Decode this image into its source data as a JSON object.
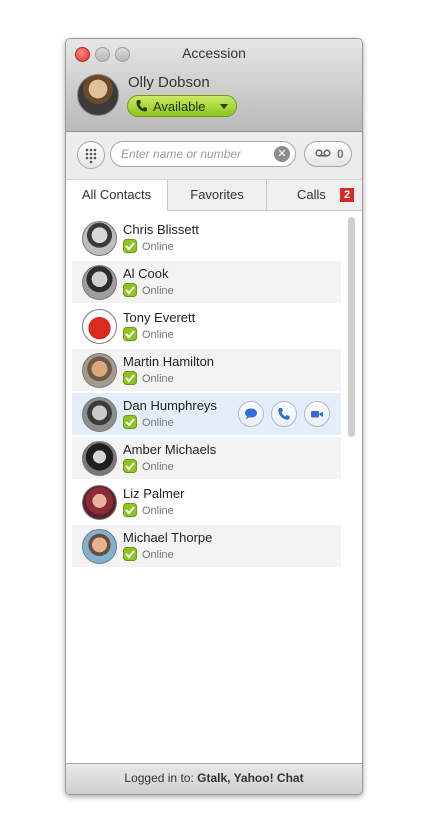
{
  "window": {
    "title": "Accession"
  },
  "user": {
    "name": "Olly Dobson",
    "status": "Available"
  },
  "toolbar": {
    "search_placeholder": "Enter name or number",
    "voicemail_count": "0"
  },
  "tabs": [
    {
      "label": "All Contacts",
      "active": true
    },
    {
      "label": "Favorites"
    },
    {
      "label": "Calls",
      "badge": "2"
    }
  ],
  "contacts": [
    {
      "name": "Chris Blissett",
      "status": "Online"
    },
    {
      "name": "Al Cook",
      "status": "Online"
    },
    {
      "name": "Tony Everett",
      "status": "Online"
    },
    {
      "name": "Martin Hamilton",
      "status": "Online"
    },
    {
      "name": "Dan Humphreys",
      "status": "Online"
    },
    {
      "name": "Amber Michaels",
      "status": "Online"
    },
    {
      "name": "Liz Palmer",
      "status": "Online"
    },
    {
      "name": "Michael Thorpe",
      "status": "Online"
    }
  ],
  "footer": {
    "prefix": "Logged in to: ",
    "services": "Gtalk, Yahoo! Chat"
  },
  "colors": {
    "accent_green": "#8fc41f",
    "badge_red": "#d42a2a",
    "hover_row": "#e4eefb",
    "action_blue": "#2f6fd6"
  }
}
